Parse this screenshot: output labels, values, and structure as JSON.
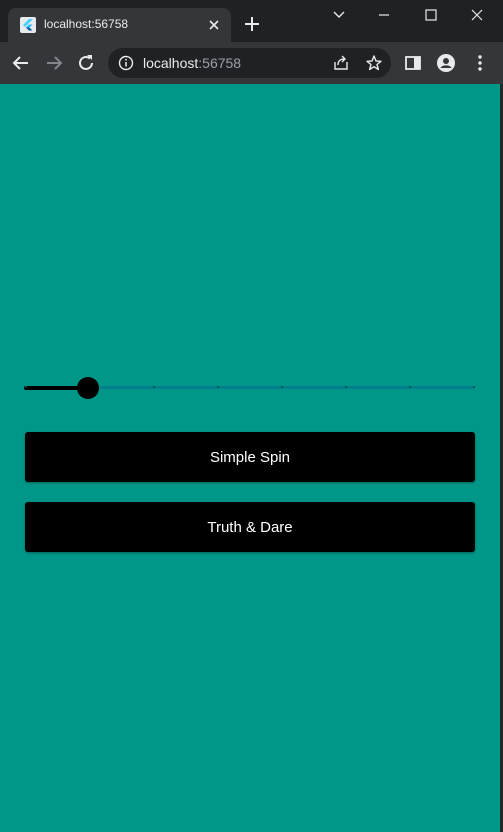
{
  "browser": {
    "tab_title": "localhost:56758",
    "url_host": "localhost",
    "url_port": ":56758"
  },
  "slider": {
    "value": 1,
    "min": 0,
    "max": 7,
    "divisions": 7
  },
  "buttons": {
    "simple_spin": "Simple Spin",
    "truth_dare": "Truth & Dare"
  },
  "colors": {
    "background": "#009688",
    "button": "#000000",
    "button_text": "#ffffff"
  }
}
